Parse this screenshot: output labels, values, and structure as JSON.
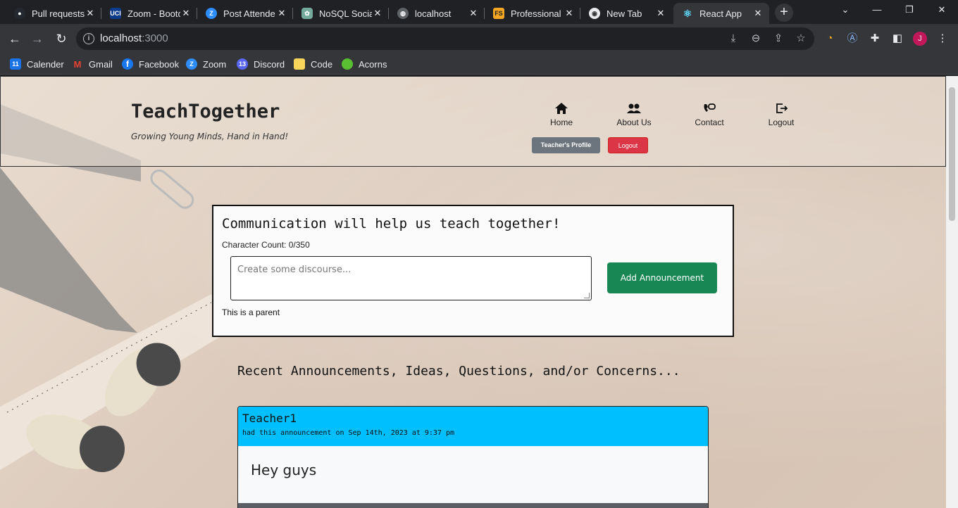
{
  "browser": {
    "tabs": [
      {
        "title": "Pull requests",
        "favicon_color": "#24292f"
      },
      {
        "title": "Zoom - Bootc",
        "favicon_color": "#0b3c8c"
      },
      {
        "title": "Post Attende",
        "favicon_color": "#2d8cff"
      },
      {
        "title": "NoSQL Social",
        "favicon_color": "#74aa9c"
      },
      {
        "title": "localhost",
        "favicon_color": "#5f6368"
      },
      {
        "title": "Professional",
        "favicon_color": "#f5a623"
      },
      {
        "title": "New Tab",
        "favicon_color": "#e8eaed"
      },
      {
        "title": "React App",
        "favicon_color": "#61dafb"
      }
    ],
    "url_host": "localhost",
    "url_port": ":3000",
    "profile_initial": "J",
    "bookmarks": [
      {
        "label": "Calender",
        "icon_color": "#1a73e8",
        "icon_text": "11"
      },
      {
        "label": "Gmail",
        "icon_color": "#ea4335",
        "icon_text": "M"
      },
      {
        "label": "Facebook",
        "icon_color": "#1877f2",
        "icon_text": "f"
      },
      {
        "label": "Zoom",
        "icon_color": "#2d8cff",
        "icon_text": "Z"
      },
      {
        "label": "Discord",
        "icon_color": "#5865f2",
        "icon_text": "13"
      },
      {
        "label": "Code",
        "icon_color": "#f9d55b",
        "icon_text": ""
      },
      {
        "label": "Acorns",
        "icon_color": "#5bbf33",
        "icon_text": ""
      }
    ]
  },
  "header": {
    "title": "TeachTogether",
    "tagline": "Growing Young Minds, Hand in Hand!",
    "nav": [
      {
        "label": "Home",
        "icon": "home-icon"
      },
      {
        "label": "About Us",
        "icon": "users-icon"
      },
      {
        "label": "Contact",
        "icon": "contact-icon"
      },
      {
        "label": "Logout",
        "icon": "logout-icon"
      }
    ],
    "profile_button": "Teacher's Profile",
    "logout_button": "Logout"
  },
  "compose": {
    "heading": "Communication will help us teach together!",
    "char_count": "Character Count: 0/350",
    "placeholder": "Create some discourse...",
    "add_button": "Add Announcement",
    "parent_note": "This is a parent"
  },
  "feed": {
    "title": "Recent Announcements, Ideas, Questions, and/or Concerns...",
    "posts": [
      {
        "author": "Teacher1",
        "meta": "had this announcement on Sep 14th, 2023 at 9:37 pm",
        "body": "Hey guys"
      }
    ]
  },
  "colors": {
    "accent_green": "#198754",
    "accent_red": "#dc3545",
    "card_header": "#00bfff",
    "secondary": "#6c757d"
  }
}
